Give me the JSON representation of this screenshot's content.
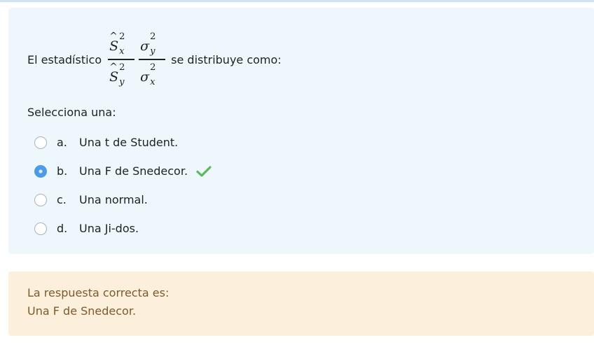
{
  "question": {
    "text_before": "El estadístico",
    "text_after": "se distribuye como:",
    "formula": {
      "left_fraction": {
        "numerator": {
          "hat": "^",
          "symbol": "S",
          "sup": "2",
          "sub": "x"
        },
        "denominator": {
          "hat": "^",
          "symbol": "S",
          "sup": "2",
          "sub": "y"
        }
      },
      "right_fraction": {
        "numerator": {
          "symbol": "σ",
          "sup": "2",
          "sub": "y"
        },
        "denominator": {
          "symbol": "σ",
          "sup": "2",
          "sub": "x"
        }
      }
    },
    "prompt": "Selecciona una:",
    "answers": [
      {
        "letter": "a.",
        "text": "Una t de Student.",
        "selected": false
      },
      {
        "letter": "b.",
        "text": "Una F de Snedecor.",
        "selected": true,
        "correct_mark": "check-icon"
      },
      {
        "letter": "c.",
        "text": "Una normal.",
        "selected": false
      },
      {
        "letter": "d.",
        "text": "Una Ji-dos.",
        "selected": false
      }
    ]
  },
  "feedback": {
    "label": "La respuesta correcta es:",
    "answer": "Una F de Snedecor."
  },
  "colors": {
    "question_bg": "#eef7fb",
    "feedback_bg": "#fcefdc",
    "feedback_text": "#7d5a29",
    "radio_selected": "#4d9be6",
    "check_green": "#5cb85c"
  }
}
